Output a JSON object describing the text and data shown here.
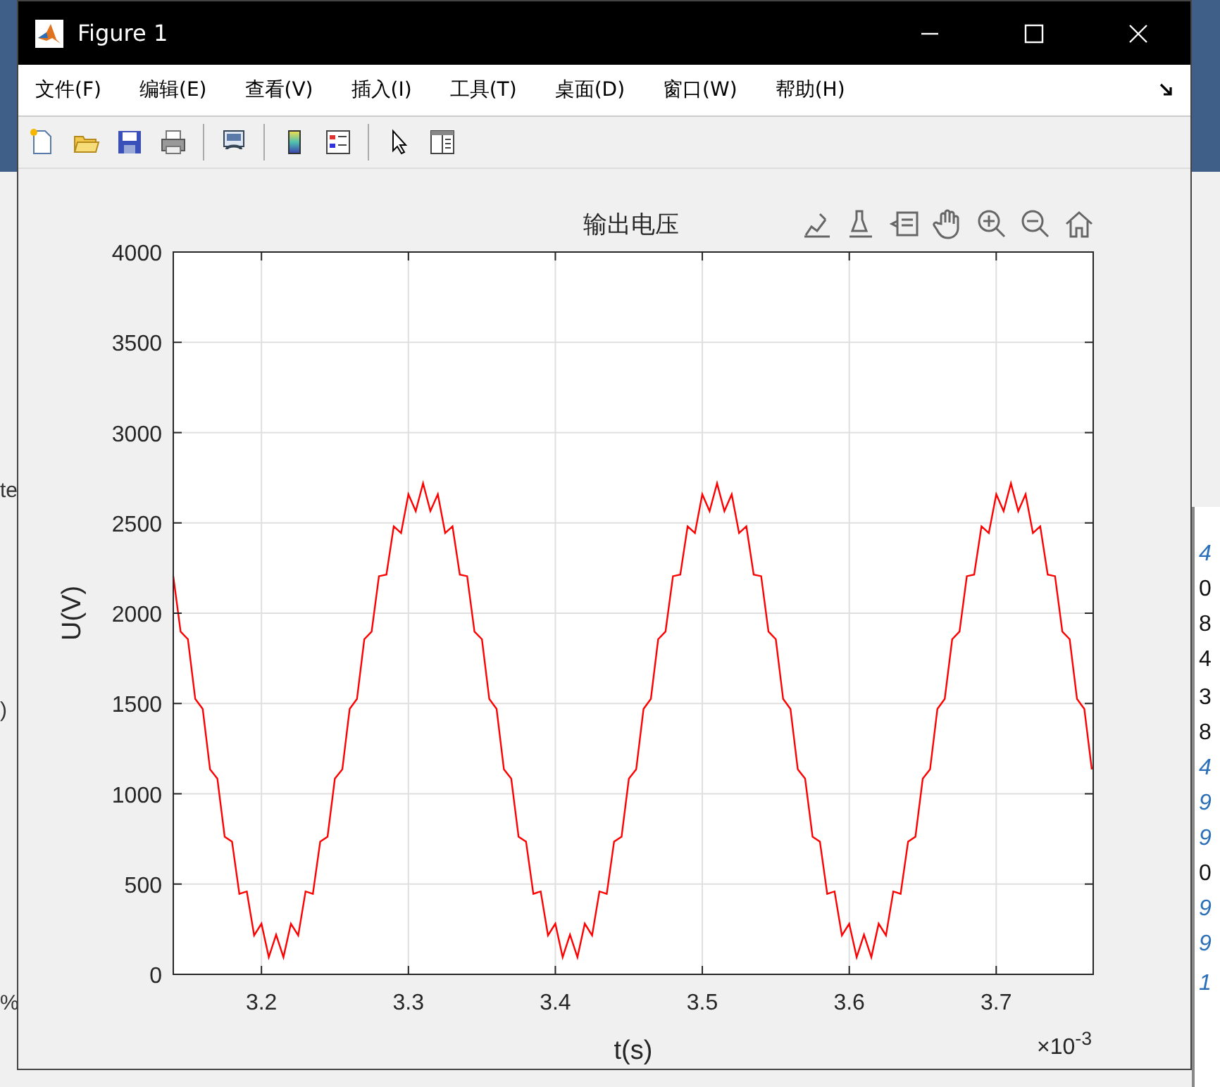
{
  "window": {
    "title": "Figure 1"
  },
  "menu": [
    {
      "label": "文件(F)"
    },
    {
      "label": "编辑(E)"
    },
    {
      "label": "查看(V)"
    },
    {
      "label": "插入(I)"
    },
    {
      "label": "工具(T)"
    },
    {
      "label": "桌面(D)"
    },
    {
      "label": "窗口(W)"
    },
    {
      "label": "帮助(H)"
    }
  ],
  "toolbar": [
    {
      "kind": "new"
    },
    {
      "kind": "open"
    },
    {
      "kind": "save"
    },
    {
      "kind": "print"
    },
    {
      "kind": "sep"
    },
    {
      "kind": "link"
    },
    {
      "kind": "sep"
    },
    {
      "kind": "colorbar"
    },
    {
      "kind": "legend"
    },
    {
      "kind": "sep"
    },
    {
      "kind": "pointer"
    },
    {
      "kind": "inspector"
    }
  ],
  "axes_toolbar": [
    {
      "kind": "edit"
    },
    {
      "kind": "brush"
    },
    {
      "kind": "datatip"
    },
    {
      "kind": "pan"
    },
    {
      "kind": "zoomin"
    },
    {
      "kind": "zoomout"
    },
    {
      "kind": "home"
    }
  ],
  "plot": {
    "exponent_label": "×10$^{-3}$",
    "chart_data": {
      "type": "line",
      "title": "输出电压",
      "xlabel": "t(s)",
      "ylabel": "U(V)",
      "xlim": [
        3.14,
        3.766
      ],
      "grid": true,
      "ylim": [
        0,
        4000
      ],
      "xticks": [
        {
          "value": 3.2,
          "label": "3.2"
        },
        {
          "value": 3.3,
          "label": "3.3"
        },
        {
          "value": 3.4,
          "label": "3.4"
        },
        {
          "value": 3.5,
          "label": "3.5"
        },
        {
          "value": 3.6,
          "label": "3.6"
        },
        {
          "value": 3.7,
          "label": "3.7"
        }
      ],
      "yticks": [
        0,
        500,
        1000,
        1500,
        2000,
        2500,
        3000,
        3500,
        4000
      ],
      "x": [
        3.14,
        3.145,
        3.15,
        3.155,
        3.16,
        3.165,
        3.17,
        3.175,
        3.18,
        3.185,
        3.19,
        3.195,
        3.2,
        3.205,
        3.21,
        3.215,
        3.22,
        3.225,
        3.23,
        3.235,
        3.24,
        3.245,
        3.25,
        3.255,
        3.26,
        3.265,
        3.27,
        3.275,
        3.28,
        3.285,
        3.29,
        3.295,
        3.3,
        3.305,
        3.31,
        3.315,
        3.32,
        3.325,
        3.33,
        3.335,
        3.34,
        3.345,
        3.35,
        3.355,
        3.36,
        3.365,
        3.37,
        3.375,
        3.38,
        3.385,
        3.39,
        3.395,
        3.4,
        3.405,
        3.41,
        3.415,
        3.42,
        3.425,
        3.43,
        3.435,
        3.44,
        3.445,
        3.45,
        3.455,
        3.46,
        3.465,
        3.47,
        3.475,
        3.48,
        3.485,
        3.49,
        3.495,
        3.5,
        3.505,
        3.51,
        3.515,
        3.52,
        3.525,
        3.53,
        3.535,
        3.54,
        3.545,
        3.55,
        3.555,
        3.56,
        3.565,
        3.57,
        3.575,
        3.58,
        3.585,
        3.59,
        3.595,
        3.6,
        3.605,
        3.61,
        3.615,
        3.62,
        3.625,
        3.63,
        3.635,
        3.64,
        3.645,
        3.65,
        3.655,
        3.66,
        3.665,
        3.67,
        3.675,
        3.68,
        3.685,
        3.69,
        3.695,
        3.7,
        3.705,
        3.71,
        3.715,
        3.72,
        3.725,
        3.73,
        3.735,
        3.74,
        3.745,
        3.75,
        3.755,
        3.76,
        3.765
      ],
      "series": [
        {
          "color": "#ff0000",
          "values": [
            2205,
            1898,
            1856,
            1525,
            1470,
            1135,
            1084,
            762,
            735,
            446,
            459,
            216,
            281,
            95,
            220,
            95,
            281,
            216,
            459,
            446,
            735,
            762,
            1084,
            1135,
            1470,
            1525,
            1856,
            1898,
            2205,
            2214,
            2481,
            2444,
            2659,
            2565,
            2720,
            2565,
            2659,
            2444,
            2481,
            2214,
            2205,
            1898,
            1856,
            1525,
            1470,
            1135,
            1084,
            762,
            735,
            446,
            459,
            216,
            281,
            95,
            220,
            95,
            281,
            216,
            459,
            446,
            735,
            762,
            1084,
            1135,
            1470,
            1525,
            1856,
            1898,
            2205,
            2214,
            2481,
            2444,
            2659,
            2565,
            2720,
            2565,
            2659,
            2444,
            2481,
            2214,
            2205,
            1898,
            1856,
            1525,
            1470,
            1135,
            1084,
            762,
            735,
            446,
            459,
            216,
            281,
            95,
            220,
            95,
            281,
            216,
            459,
            446,
            735,
            762,
            1084,
            1135,
            1470,
            1525,
            1856,
            1898,
            2205,
            2214,
            2481,
            2444,
            2659,
            2565,
            2720,
            2565,
            2659,
            2444,
            2481,
            2214,
            2205,
            1898,
            1856,
            1525,
            1470,
            1135
          ]
        }
      ]
    }
  },
  "background_left": [
    {
      "text": "te"
    },
    {
      "text": ")"
    },
    {
      "text": "%"
    }
  ],
  "background_right": [
    {
      "text": "4",
      "kind": "italic"
    },
    {
      "text": "0",
      "kind": "plain"
    },
    {
      "text": "8",
      "kind": "plain"
    },
    {
      "text": "4",
      "kind": "plain"
    },
    {
      "text": "3",
      "kind": "plain"
    },
    {
      "text": "8",
      "kind": "plain"
    },
    {
      "text": "4",
      "kind": "italic"
    },
    {
      "text": "9",
      "kind": "italic"
    },
    {
      "text": "9",
      "kind": "italic"
    },
    {
      "text": "0",
      "kind": "plain"
    },
    {
      "text": "9",
      "kind": "italic"
    },
    {
      "text": "9",
      "kind": "italic"
    },
    {
      "text": "1",
      "kind": "italic"
    }
  ]
}
